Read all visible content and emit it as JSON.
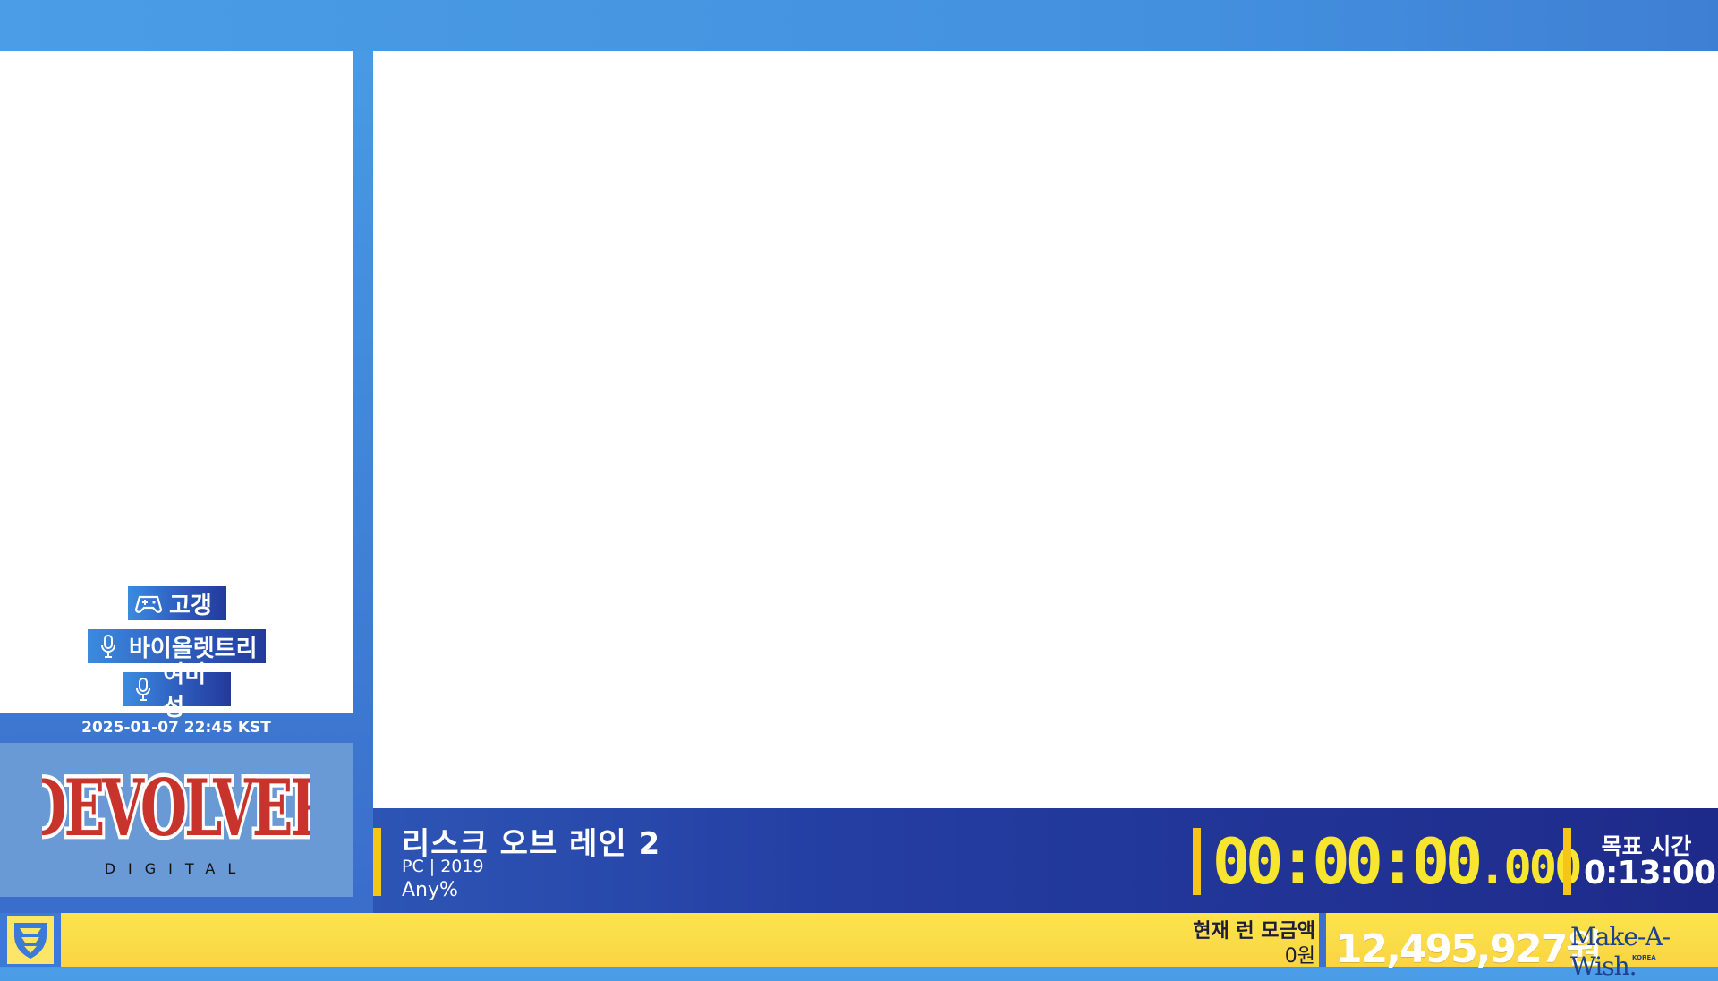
{
  "credits": {
    "runner": {
      "label": "고갱",
      "icon": "gamepad-icon"
    },
    "commentators": [
      {
        "label": "바이올렛트리",
        "icon": "microphone-icon"
      },
      {
        "label": "여비성",
        "icon": "microphone-icon"
      }
    ]
  },
  "datetime": "2025-01-07 22:45 KST",
  "sponsor": {
    "name": "DEVOLVER",
    "sub": "DIGITAL"
  },
  "game": {
    "title": "리스크 오브 레인 2",
    "meta": "PC | 2019",
    "category": "Any%"
  },
  "timer": {
    "main": "00:00:00",
    "ms": ".000"
  },
  "target": {
    "label": "목표 시간",
    "time": "0:13:00"
  },
  "donation": {
    "run_label": "현재 런 모금액",
    "run_amount": "0원",
    "total": "12,495,927원",
    "charity": "Make-A-Wish.",
    "charity_sub": "KOREA"
  },
  "colors": {
    "accent_yellow": "#f8e52f",
    "bar_yellow": "#fbe44c",
    "bar_blue": "#1e2a8a",
    "frame_blue": "#4a9de6"
  }
}
